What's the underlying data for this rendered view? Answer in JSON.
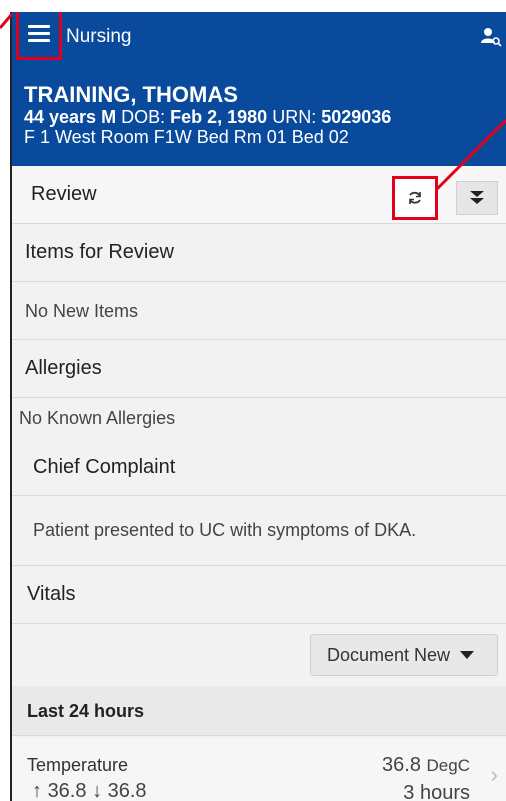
{
  "appbar": {
    "title": "Nursing",
    "menu_icon": "hamburger-menu-icon",
    "user_icon": "user-search-icon"
  },
  "patient": {
    "name": "TRAINING, THOMAS",
    "age_sex": "44 years M",
    "dob_label": "DOB:",
    "dob": "Feb 2, 1980",
    "urn_label": "URN:",
    "urn": "5029036",
    "location": "F 1 West Room F1W Bed Rm 01 Bed 02"
  },
  "review": {
    "title": "Review",
    "refresh_icon": "refresh-icon",
    "collapse_icon": "double-chevron-down-icon"
  },
  "items_for_review": {
    "title": "Items for Review",
    "value": "No New Items"
  },
  "allergies": {
    "title": "Allergies",
    "value": "No Known Allergies"
  },
  "chief_complaint": {
    "title": "Chief Complaint",
    "value": "Patient presented to UC with symptoms of DKA."
  },
  "vitals": {
    "title": "Vitals",
    "document_button": "Document New",
    "last24_label": "Last 24 hours",
    "temperature": {
      "label": "Temperature",
      "value": "36.8",
      "unit": "DegC",
      "high": "36.8",
      "low": "36.8",
      "time_ago": "3 hours"
    }
  },
  "colors": {
    "header_blue": "#0a4a9c",
    "highlight_red": "#e2001a"
  }
}
